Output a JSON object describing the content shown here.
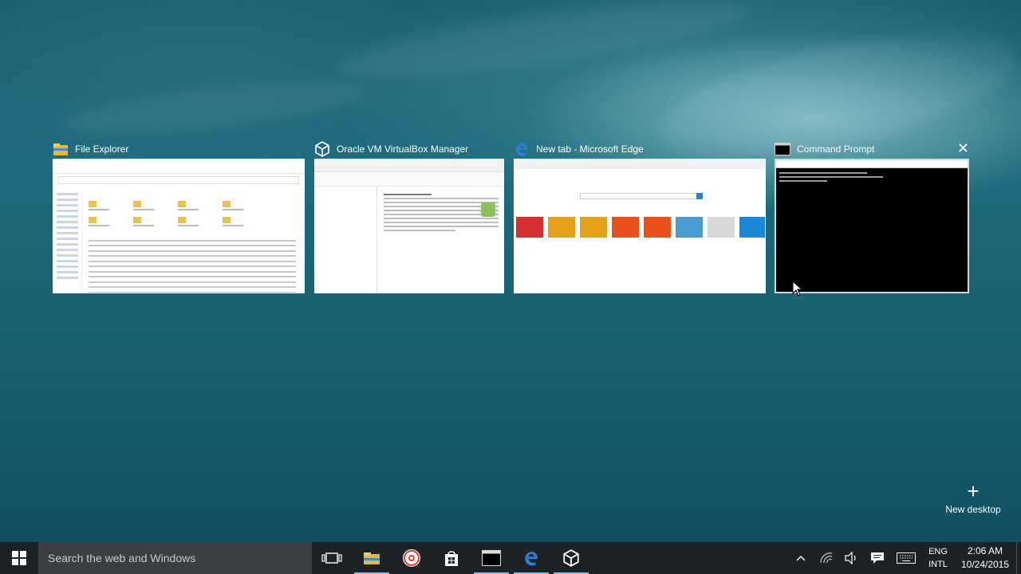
{
  "task_view": {
    "windows": [
      {
        "title": "File Explorer",
        "icon": "file-explorer-icon"
      },
      {
        "title": "Oracle VM VirtualBox Manager",
        "icon": "virtualbox-icon"
      },
      {
        "title": "New tab - Microsoft Edge",
        "icon": "edge-icon"
      },
      {
        "title": "Command Prompt",
        "icon": "cmd-icon",
        "close_glyph": "✕"
      }
    ],
    "edge_tile_colors": [
      "#d63031",
      "#e6a21c",
      "#e6a21c",
      "#e8501e",
      "#e8501e",
      "#4a9bd1",
      "#d8d8d8",
      "#1e88d8"
    ]
  },
  "new_desktop": {
    "plus": "+",
    "label": "New desktop"
  },
  "taskbar": {
    "search_placeholder": "Search the web and Windows",
    "pinned": [
      "task-view-icon",
      "file-explorer-icon",
      "chrome-icon",
      "store-icon",
      "cmd-icon",
      "edge-icon",
      "virtualbox-icon"
    ],
    "language": {
      "line1": "ENG",
      "line2": "INTL"
    },
    "clock": {
      "time": "2:06 AM",
      "date": "10/24/2015"
    },
    "colors": {
      "bar": "#1d2224",
      "search": "#3c3f42",
      "accent": "#2d7fd3"
    }
  }
}
